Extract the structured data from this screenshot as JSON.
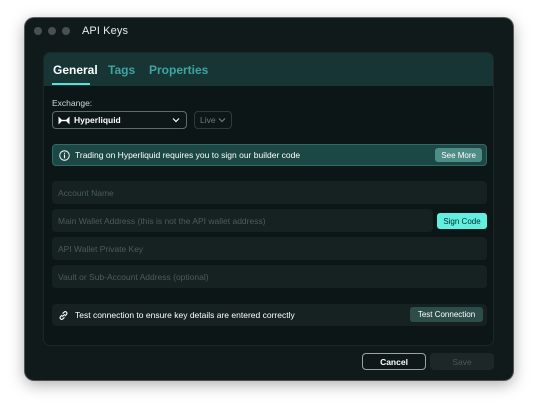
{
  "window": {
    "title": "API Keys"
  },
  "tabs": [
    {
      "label": "General",
      "active": true
    },
    {
      "label": "Tags",
      "active": false
    },
    {
      "label": "Properties",
      "active": false
    }
  ],
  "exchange": {
    "label": "Exchange:",
    "selected": "Hyperliquid",
    "mode": "Live"
  },
  "info_banner": {
    "text": "Trading on Hyperliquid requires you to sign our builder code",
    "button": "See More"
  },
  "fields": {
    "account_name": {
      "placeholder": "Account Name",
      "value": ""
    },
    "main_wallet": {
      "placeholder": "Main Wallet Address (this is not the API wallet address)",
      "value": ""
    },
    "private_key": {
      "placeholder": "API Wallet Private Key",
      "value": ""
    },
    "vault": {
      "placeholder": "Vault or Sub-Account Address (optional)",
      "value": ""
    }
  },
  "sign_button": "Sign Code",
  "test": {
    "text": "Test connection to ensure key details are entered correctly",
    "button": "Test Connection"
  },
  "footer": {
    "cancel": "Cancel",
    "save": "Save"
  },
  "colors": {
    "accent": "#52e6da",
    "banner": "#1b4845",
    "background": "#101a1a"
  },
  "icons": [
    "info-icon",
    "link-icon",
    "chevron-down-icon",
    "hyperliquid-logo-icon"
  ]
}
